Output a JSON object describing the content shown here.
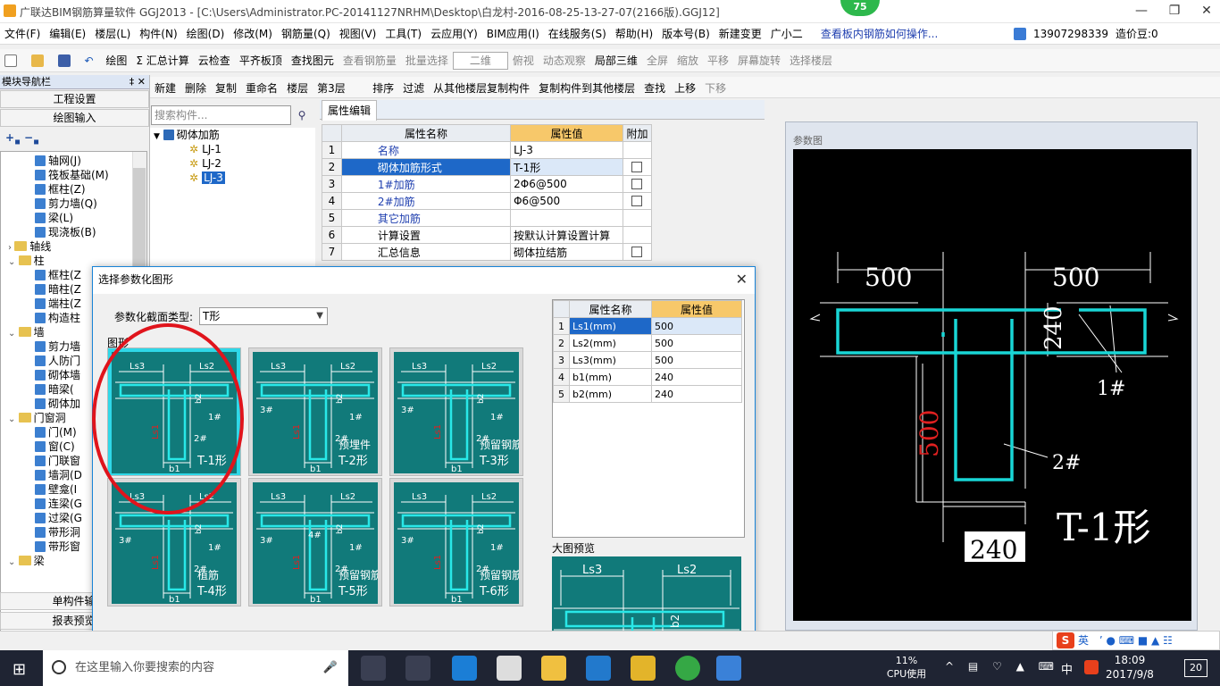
{
  "window": {
    "title": "广联达BIM钢筋算量软件 GGJ2013 - [C:\\Users\\Administrator.PC-20141127NRHM\\Desktop\\白龙村-2016-08-25-13-27-07(2166版).GGJ12]",
    "badge": "75"
  },
  "menu": [
    "文件(F)",
    "编辑(E)",
    "楼层(L)",
    "构件(N)",
    "绘图(D)",
    "修改(M)",
    "钢筋量(Q)",
    "视图(V)",
    "工具(T)",
    "云应用(Y)",
    "BIM应用(I)",
    "在线服务(S)",
    "帮助(H)",
    "版本号(B)",
    "新建变更",
    "广小二",
    "查看板内钢筋如何操作..."
  ],
  "menu_right": {
    "phone": "13907298339",
    "price": "造价豆:0"
  },
  "toolbar1": [
    "绘图",
    "Σ 汇总计算",
    "云检查",
    "平齐板顶",
    "查找图元",
    "查看钢筋量",
    "批量选择",
    "二维",
    "俯视",
    "动态观察",
    "局部三维",
    "全屏",
    "缩放",
    "平移",
    "屏幕旋转",
    "选择楼层"
  ],
  "toolbar2": [
    "新建",
    "删除",
    "复制",
    "重命名",
    "楼层",
    "第3层",
    "排序",
    "过滤",
    "从其他楼层复制构件",
    "复制构件到其他楼层",
    "查找",
    "上移",
    "下移"
  ],
  "nav": {
    "header": "模块导航栏",
    "buttons": [
      "工程设置",
      "绘图输入"
    ],
    "tree": [
      {
        "label": "轴网(J)",
        "indent": 3,
        "kind": "item"
      },
      {
        "label": "筏板基础(M)",
        "indent": 3,
        "kind": "item"
      },
      {
        "label": "框柱(Z)",
        "indent": 3,
        "kind": "item"
      },
      {
        "label": "剪力墙(Q)",
        "indent": 3,
        "kind": "item"
      },
      {
        "label": "梁(L)",
        "indent": 3,
        "kind": "item"
      },
      {
        "label": "现浇板(B)",
        "indent": 3,
        "kind": "item"
      },
      {
        "label": "轴线",
        "indent": 1,
        "kind": "folder"
      },
      {
        "label": "柱",
        "indent": 1,
        "kind": "folder"
      },
      {
        "label": "框柱(Z",
        "indent": 3,
        "kind": "item"
      },
      {
        "label": "暗柱(Z",
        "indent": 3,
        "kind": "item"
      },
      {
        "label": "端柱(Z",
        "indent": 3,
        "kind": "item"
      },
      {
        "label": "构造柱",
        "indent": 3,
        "kind": "item"
      },
      {
        "label": "墙",
        "indent": 1,
        "kind": "folder"
      },
      {
        "label": "剪力墙",
        "indent": 3,
        "kind": "item"
      },
      {
        "label": "人防门",
        "indent": 3,
        "kind": "item"
      },
      {
        "label": "砌体墙",
        "indent": 3,
        "kind": "item"
      },
      {
        "label": "暗梁(",
        "indent": 3,
        "kind": "item"
      },
      {
        "label": "砌体加",
        "indent": 3,
        "kind": "item"
      },
      {
        "label": "门窗洞",
        "indent": 1,
        "kind": "folder"
      },
      {
        "label": "门(M)",
        "indent": 3,
        "kind": "item"
      },
      {
        "label": "窗(C)",
        "indent": 3,
        "kind": "item"
      },
      {
        "label": "门联窗",
        "indent": 3,
        "kind": "item"
      },
      {
        "label": "墙洞(D",
        "indent": 3,
        "kind": "item"
      },
      {
        "label": "壁龛(I",
        "indent": 3,
        "kind": "item"
      },
      {
        "label": "连梁(G",
        "indent": 3,
        "kind": "item"
      },
      {
        "label": "过梁(G",
        "indent": 3,
        "kind": "item"
      },
      {
        "label": "带形洞",
        "indent": 3,
        "kind": "item"
      },
      {
        "label": "带形窗",
        "indent": 3,
        "kind": "item"
      },
      {
        "label": "梁",
        "indent": 1,
        "kind": "folder"
      }
    ],
    "bottom_buttons": [
      "单构件输",
      "报表预览"
    ]
  },
  "search": {
    "placeholder": "搜索构件..."
  },
  "components": {
    "root": "砌体加筋",
    "items": [
      "LJ-1",
      "LJ-2",
      "LJ-3"
    ],
    "selected": "LJ-3"
  },
  "prop_tab": "属性编辑",
  "prop_table": {
    "headers": [
      "属性名称",
      "属性值",
      "附加"
    ],
    "rows": [
      {
        "n": "1",
        "name": "名称",
        "value": "LJ-3",
        "chk": false,
        "blue": true
      },
      {
        "n": "2",
        "name": "砌体加筋形式",
        "value": "T-1形",
        "chk": true,
        "blue": false
      },
      {
        "n": "3",
        "name": "1#加筋",
        "value": "2Φ6@500",
        "chk": true,
        "blue": true
      },
      {
        "n": "4",
        "name": "2#加筋",
        "value": "Φ6@500",
        "chk": true,
        "blue": true
      },
      {
        "n": "5",
        "name": "其它加筋",
        "value": "",
        "chk": false,
        "blue": true
      },
      {
        "n": "6",
        "name": "计算设置",
        "value": "按默认计算设置计算",
        "chk": false,
        "blue": false
      },
      {
        "n": "7",
        "name": "汇总信息",
        "value": "砌体拉结筋",
        "chk": true,
        "blue": false
      }
    ]
  },
  "param_panel": {
    "label": "参数图",
    "dims": {
      "ls3": "500",
      "ls2": "500",
      "b2": "240",
      "ls1": "500",
      "b1": "240"
    },
    "marks": {
      "bar1": "1#",
      "bar2": "2#",
      "shape": "T-1形"
    }
  },
  "dialog": {
    "title": "选择参数化图形",
    "type_label": "参数化截面类型:",
    "type_value": "T形",
    "group_label": "图形",
    "shapes": [
      {
        "name": "T-1形",
        "sub": ""
      },
      {
        "name": "T-2形",
        "sub": "预埋件"
      },
      {
        "name": "T-3形",
        "sub": "预留钢筋"
      },
      {
        "name": "T-4形",
        "sub": "植筋"
      },
      {
        "name": "T-5形",
        "sub": "预留钢筋"
      },
      {
        "name": "T-6形",
        "sub": "预留钢筋"
      }
    ],
    "tile_labels": {
      "ls3": "Ls3",
      "ls2": "Ls2",
      "b2": "b2",
      "b1": "b1",
      "ls1": "Ls1",
      "r1": "1#",
      "r2": "2#",
      "r3": "3#",
      "r4": "4#"
    },
    "param_table": {
      "headers": [
        "属性名称",
        "属性值"
      ],
      "rows": [
        {
          "n": "1",
          "name": "Ls1(mm)",
          "value": "500"
        },
        {
          "n": "2",
          "name": "Ls2(mm)",
          "value": "500"
        },
        {
          "n": "3",
          "name": "Ls3(mm)",
          "value": "500"
        },
        {
          "n": "4",
          "name": "b1(mm)",
          "value": "240"
        },
        {
          "n": "5",
          "name": "b2(mm)",
          "value": "240"
        }
      ]
    },
    "preview_label": "大图预览",
    "preview_labels": {
      "ls3": "Ls3",
      "ls2": "Ls2",
      "b2": "b2"
    }
  },
  "ime": {
    "lang": "英"
  },
  "taskbar": {
    "search_placeholder": "在这里输入你要搜索的内容",
    "cpu_value": "11%",
    "cpu_label": "CPU使用",
    "ime_lang": "中",
    "time": "18:09",
    "date": "2017/9/8",
    "notifications": "20"
  }
}
